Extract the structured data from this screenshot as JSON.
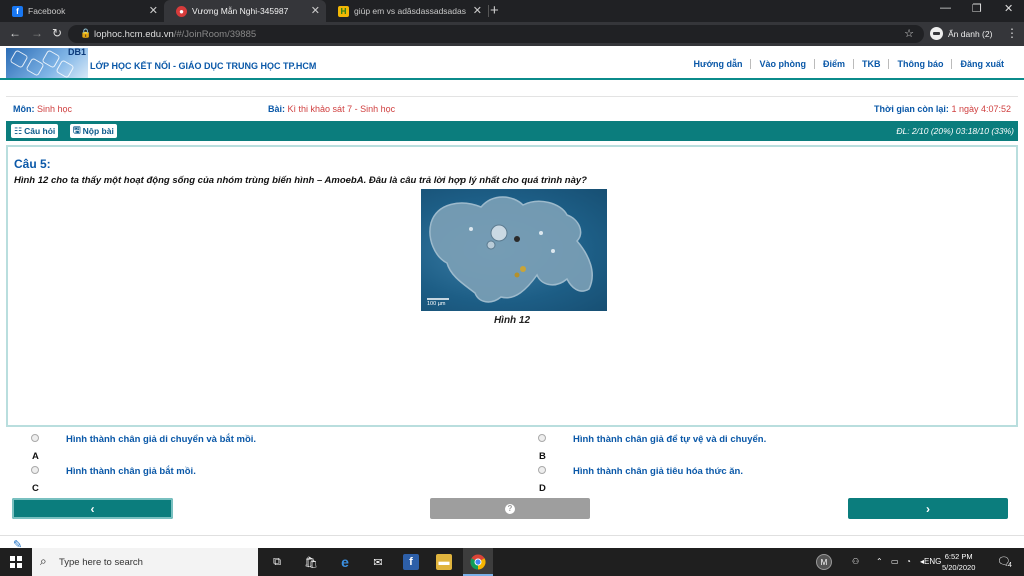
{
  "browser": {
    "tabs": [
      {
        "title": "Facebook",
        "icon": "facebook-icon",
        "color": "#1877f2"
      },
      {
        "title": "Vương Mẫn Nghi-345987",
        "icon": "site-icon",
        "color": "#d63b3b"
      },
      {
        "title": "giúp em vs adâsdassadsadas cầu",
        "icon": "hoidap-icon",
        "color": "#f2b705"
      }
    ],
    "url_domain": "lophoc.hcm.edu.vn",
    "url_path": "/#/JoinRoom/39885",
    "profile_label": "Ẩn danh (2)"
  },
  "site": {
    "logo_code": "DB1",
    "title": "LỚP HỌC KẾT NỐI -  GIÁO DỤC TRUNG HỌC TP.HCM",
    "nav": [
      "Hướng dẫn",
      "Vào phòng",
      "Điểm",
      "TKB",
      "Thông báo",
      "Đăng xuất"
    ],
    "accent": "#0b7d7d",
    "link_color": "#0a58a8"
  },
  "info": {
    "subject_label": "Môn:",
    "subject": "Sinh học",
    "lesson_label": "Bài:",
    "lesson": "Kì thi khảo sát 7 - Sinh học",
    "time_label": "Thời gian còn lại:",
    "time_value": "1 ngày 4:07:52"
  },
  "toolbar": {
    "questions_label": "Câu hỏi",
    "submit_label": "Nộp bài",
    "progress": "ĐL: 2/10 (20%)  03:18/10 (33%)"
  },
  "question": {
    "title": "Câu 5:",
    "text": "Hình 12 cho ta thấy một hoạt động sống của nhóm trùng biến hình – AmoebA. Đâu là câu trả lời hợp lý nhất cho quá trình này?",
    "figure_scale": "100 µm",
    "caption": "Hình 12"
  },
  "answers": [
    {
      "letter": "A",
      "text": "Hình thành chân giả di chuyển và bắt mồi."
    },
    {
      "letter": "B",
      "text": "Hình thành chân giả để tự vệ và di chuyển."
    },
    {
      "letter": "C",
      "text": "Hình thành chân giả bắt mồi."
    },
    {
      "letter": "D",
      "text": "Hình thành chân giả tiêu hóa thức ăn."
    }
  ],
  "taskbar": {
    "search_placeholder": "Type here to search",
    "language": "ENG",
    "time": "6:52 PM",
    "date": "5/20/2020",
    "notification_count": "4",
    "user_initial": "M"
  }
}
